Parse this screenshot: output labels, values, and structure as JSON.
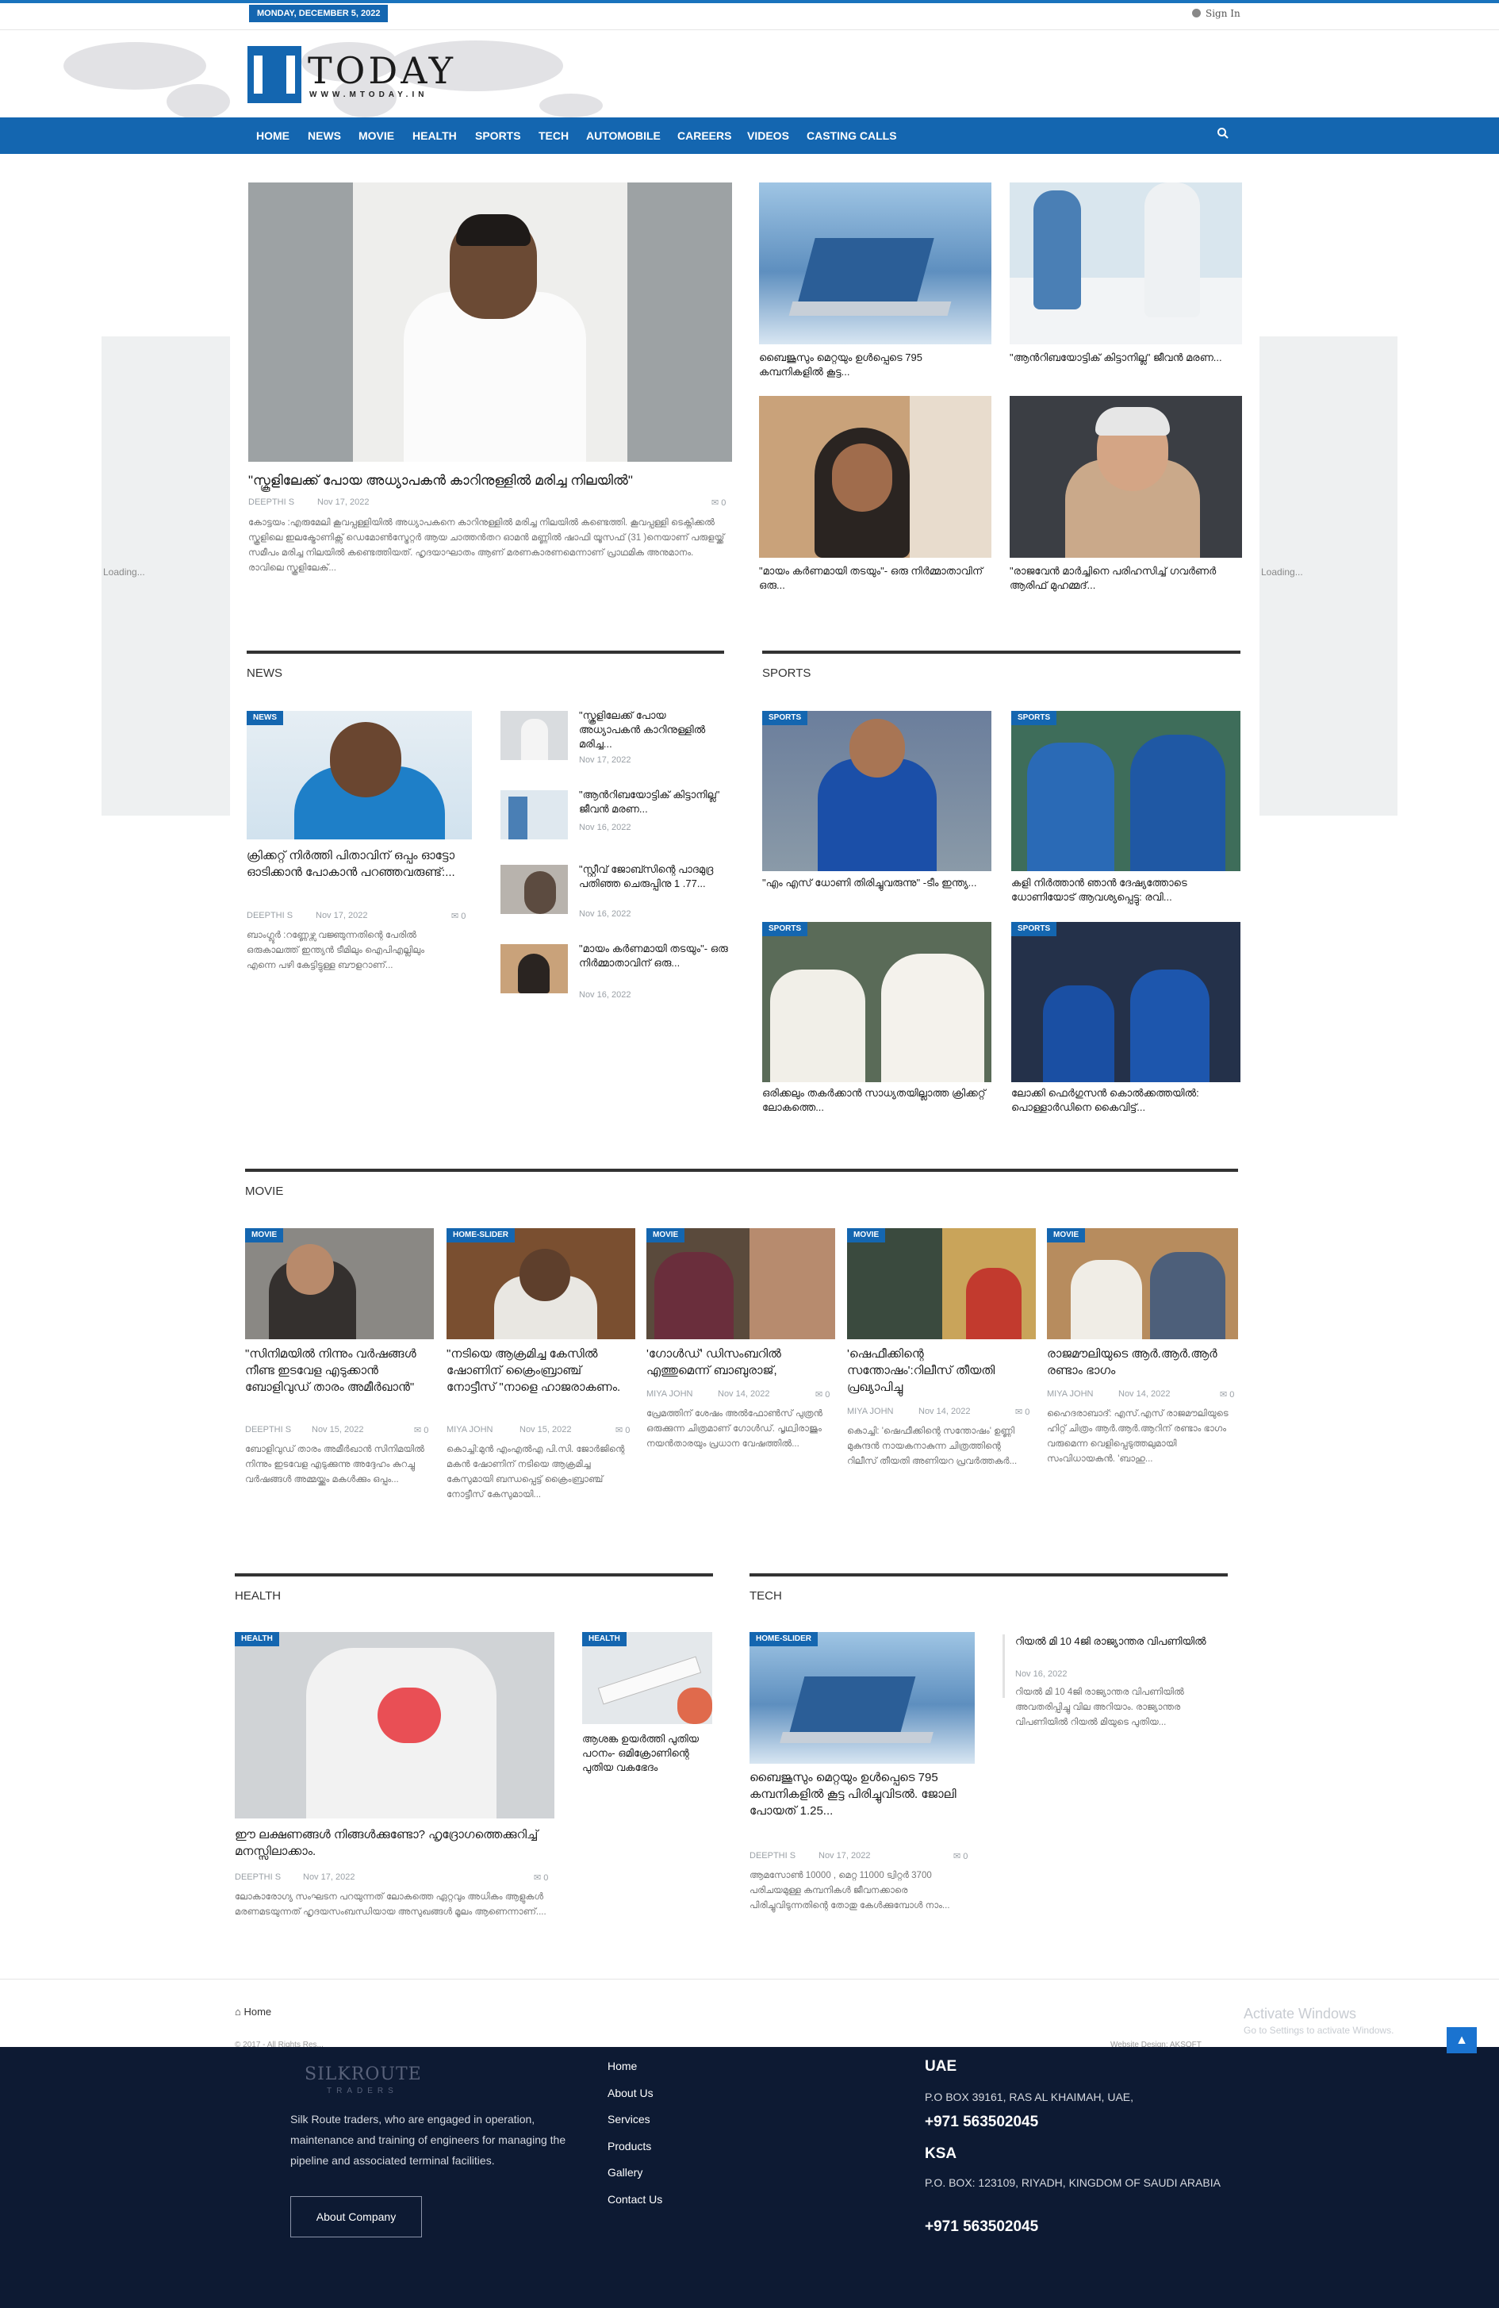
{
  "topbar": {
    "date": "MONDAY, DECEMBER 5, 2022",
    "signin": "Sign In"
  },
  "logo": {
    "word": "TODAY",
    "url": "WWW.MTODAY.IN"
  },
  "nav": {
    "items": [
      "HOME",
      "NEWS",
      "MOVIE",
      "HEALTH",
      "SPORTS",
      "TECH",
      "AUTOMOBILE",
      "CAREERS",
      "VIDEOS",
      "CASTING CALLS"
    ]
  },
  "side": {
    "loading": "Loading..."
  },
  "featured": {
    "main": {
      "title": "\"സ്കൂളിലേക്ക് പോയ അധ്യാപകൻ കാറിനുള്ളിൽ മരിച്ച നിലയിൽ\"",
      "author": "DEEPTHI S",
      "date": "Nov 17, 2022",
      "comments": "0",
      "excerpt": "കോട്ടയം :എരുമേലി കൂവപ്പള്ളിയിൽ അധ്യാപകനെ കാറിനുള്ളിൽ മരിച്ച നിലയിൽ കണ്ടെത്തി. കൂവപ്പള്ളി ടെക്നിക്കൽ സ്കൂളിലെ ഇലക്ട്രോണിക്സ് ഡെമോൺസ്ട്രേറ്റർ ആയ ചാത്തൻതറ ഓമൻ മണ്ണിൽ ഷാഫി യൂസഫ് (31 )നെയാണ് പരുളയ്ക്ക് സമീപം മരിച്ച നിലയിൽ കണ്ടെത്തിയത്. ഹൃദയാഘാതം ആണ് മരണകാരണമെന്നാണ് പ്രാഥമിക അനുമാനം. രാവിലെ സ്കൂളിലേക്..."
    },
    "grid": [
      {
        "title": "ബൈജൂസും മെറ്റയും ഉൾപ്പെടെ 795 കമ്പനികളിൽ കൂട്ട..."
      },
      {
        "title": "\"ആൻറിബയോട്ടിക് കിട്ടാനില്ല\" ജീവൻ മരണ..."
      },
      {
        "title": "\"മായം കർണമായി തടയും\"- ഒരു നിർമ്മാതാവിന് ഒരു..."
      },
      {
        "title": "\"രാജവേൻ മാർച്ചിനെ പരിഹസിച്ച് ഗവർണർ ആരിഫ് മുഹമ്മദ്..."
      }
    ]
  },
  "news": {
    "header": "NEWS",
    "main": {
      "tag": "NEWS",
      "title": "ക്രിക്കറ്റ് നിർത്തി പിതാവിന് ഒപ്പം ഓട്ടോ ഓടിക്കാൻ പോകാൻ പറഞ്ഞവരുണ്ട്:...",
      "author": "DEEPTHI S",
      "date": "Nov 17, 2022",
      "comments": "0",
      "excerpt": "ബാംഗ്ലൂർ :റണ്ണേഴ്സ വജ്ഞുന്നതിന്റെ പേരിൽ ഒരുകാലത്ത് ഇന്ത്യൻ ടീമിലും ഐപിഎല്ലിലും എന്നെ പഴി കേട്ടിട്ടുള്ള ബൗളറാണ്..."
    },
    "list": [
      {
        "title": "\"സ്കൂളിലേക്ക് പോയ അധ്യാപകൻ കാറിനുള്ളിൽ മരിച്ച...",
        "date": "Nov 17, 2022"
      },
      {
        "title": "\"ആൻറിബയോട്ടിക് കിട്ടാനില്ല\" ജീവൻ മരണ...",
        "date": "Nov 16, 2022"
      },
      {
        "title": "\"സ്റ്റീവ് ജോബ്സിന്റെ പാദമുദ്ര പതിഞ്ഞ ചെരുപ്പിനു 1 .77...",
        "date": "Nov 16, 2022"
      },
      {
        "title": "\"മായം കർണമായി തടയും\"- ഒരു നിർമ്മാതാവിന് ഒരു...",
        "date": "Nov 16, 2022"
      }
    ]
  },
  "sports": {
    "header": "SPORTS",
    "items": [
      {
        "tag": "SPORTS",
        "title": "\"എം എസ് ധോണി തിരിച്ചുവരുന്നു\" -ടീം ഇന്ത്യ..."
      },
      {
        "tag": "SPORTS",
        "title": "കളി നിർത്താൻ ഞാൻ ദേഷ്യത്തോടെ ധോണിയോട് ആവശ്യപ്പെട്ടു: രവി..."
      },
      {
        "tag": "SPORTS",
        "title": "ഒരിക്കലും തകർക്കാൻ സാധ്യതയില്ലാത്ത ക്രിക്കറ്റ് ലോകത്തെ..."
      },
      {
        "tag": "SPORTS",
        "title": "ലോക്കി ഫെർഗുസൻ കൊൽക്കത്തയിൽ: പൊള്ളാർഡിനെ കൈവിട്ട്..."
      }
    ]
  },
  "movie": {
    "header": "MOVIE",
    "items": [
      {
        "tag": "MOVIE",
        "title": "\"സിനിമയിൽ നിന്നും വർഷങ്ങൾ നീണ്ട ഇടവേള എടുക്കാൻ ബോളിവുഡ് താരം അമീർഖാൻ\"",
        "author": "DEEPTHI S",
        "date": "Nov 15, 2022",
        "comments": "0",
        "excerpt": "ബോളിവുഡ് താരം അമീർഖാൻ സിനിമയിൽ നിന്നും ഇടവേള എടുക്കുന്നു അദ്ദേഹം കുറച്ചു വർഷങ്ങൾ അമ്മയ്ക്കും മകൾക്കും ഒപ്പം..."
      },
      {
        "tag": "HOME-SLIDER",
        "title": "\"നടിയെ ആക്രമിച്ച കേസിൽ ഷോണിന് ക്രൈംബ്രാഞ്ച് നോട്ടീസ് \"നാളെ ഹാജരാകണം.",
        "author": "MIYA JOHN",
        "date": "Nov 15, 2022",
        "comments": "0",
        "excerpt": "കൊച്ചി:മുൻ എംഎൽഎ പി.സി. ജോർജിന്റെ മകൻ ഷോണിന് നടിയെ ആക്രമിച്ച കേസുമായി ബന്ധപ്പെട്ട് ക്രൈംബ്രാഞ്ച് നോട്ടീസ് കേസുമായി..."
      },
      {
        "tag": "MOVIE",
        "title": "'ഗോൾഡ്' ഡിസംബറിൽ എത്തുമെന്ന് ബാബുരാജ്,",
        "author": "MIYA JOHN",
        "date": "Nov 14, 2022",
        "comments": "0",
        "excerpt": "പ്രേമത്തിന് ശേഷം അൽഫോൺസ് പുത്രൻ ഒരുക്കുന്ന ചിത്രമാണ് ഗോൾഡ്. പൃഥ്വിരാജും നയൻതാരയും പ്രധാന വേഷത്തിൽ..."
      },
      {
        "tag": "MOVIE",
        "title": "'ഷെഫീക്കിന്റെ സന്തോഷം':റിലീസ് തീയതി പ്രഖ്യാപിച്ചു",
        "author": "MIYA JOHN",
        "date": "Nov 14, 2022",
        "comments": "0",
        "excerpt": "കൊച്ചി: 'ഷെഫീക്കിന്റെ സന്തോഷം' ഉണ്ണി മുകുന്ദൻ നായകനാകുന്ന ചിത്രത്തിന്റെ റിലീസ് തീയതി അണിയറ പ്രവർത്തകർ..."
      },
      {
        "tag": "MOVIE",
        "title": "രാജമൗലിയുടെ ആർ.ആർ.ആർ രണ്ടാം ഭാഗം",
        "author": "MIYA JOHN",
        "date": "Nov 14, 2022",
        "comments": "0",
        "excerpt": "ഹൈദരാബാദ്: എസ്.എസ് രാജമൗലിയുടെ ഹിറ്റ് ചിത്രം ആർ.ആർ.ആറിന് രണ്ടാം ഭാഗം വരുമെന്ന വെളിപ്പെടുത്തലുമായി സംവിധായകൻ. 'ബാഹു..."
      }
    ]
  },
  "health": {
    "header": "HEALTH",
    "main": {
      "tag": "HEALTH",
      "title": "ഈ ലക്ഷണങ്ങൾ നിങ്ങൾക്കുണ്ടോ? ഹൃദ്രോഗത്തെക്കുറിച്ച് മനസ്സിലാക്കാം.",
      "author": "DEEPTHI S",
      "date": "Nov 17, 2022",
      "comments": "0",
      "excerpt": "ലോകാരോഗ്യ സംഘടന പറയുന്നത് ലോകത്തെ ഏറ്റവും അധികം ആളുകൾ മരണമടയുന്നത് ഹൃദയസംബന്ധിയായ അസുഖങ്ങൾ മൂലം ആണെന്നാണ്...."
    },
    "side": {
      "tag": "HEALTH",
      "title": "ആശങ്ക ഉയർത്തി പുതിയ പഠനം- ഒമിക്രോണിന്റെ പുതിയ വകഭേദം"
    }
  },
  "tech": {
    "header": "TECH",
    "main": {
      "tag": "HOME-SLIDER",
      "title": "ബൈജൂസും മെറ്റയും ഉൾപ്പെടെ 795 കമ്പനികളിൽ കൂട്ട പിരിച്ചുവിടൽ. ജോലി പോയത് 1.25...",
      "author": "DEEPTHI S",
      "date": "Nov 17, 2022",
      "comments": "0",
      "excerpt": "ആമസോൺ 10000 , മെറ്റ 11000 ട്വിറ്റർ 3700 പരിചയമുള്ള കമ്പനികൾ ജീവനക്കാരെ പിരിച്ചുവിടുന്നതിന്റെ തോതു കേൾക്കുമ്പോൾ നാം..."
    },
    "side": {
      "title": "റിയൽ മി 10 4ജി രാജ്യാന്തര വിപണിയിൽ",
      "date": "Nov 16, 2022",
      "excerpt": "റിയൽ മി 10 4ജി രാജ്യാന്തര വിപണിയിൽ അവതരിപ്പിച്ചു വില അറിയാം. രാജ്യാന്തര വിപണിയിൽ റിയൽ മിയുടെ പുതിയ..."
    }
  },
  "bottom": {
    "home": "Home",
    "copyright": "© 2017 - All Rights Res...",
    "design": "Website Design: AKSOFT",
    "activate_title": "Activate Windows",
    "activate_sub": "Go to Settings to activate Windows."
  },
  "footer": {
    "brand": "SILKROUTE",
    "brand_sub": "TRADERS",
    "about": "Silk Route traders, who are engaged in operation, maintenance and training of engineers for managing the pipeline and associated terminal facilities.",
    "about_button": "About Company",
    "links": [
      "Home",
      "About Us",
      "Services",
      "Products",
      "Gallery",
      "Contact Us"
    ],
    "uae_title": "UAE",
    "uae_address": "P.O BOX 39161, RAS AL KHAIMAH, UAE,",
    "uae_phone": "+971 563502045",
    "ksa_title": "KSA",
    "ksa_address": "P.O. BOX: 123109, RIYADH, KINGDOM OF SAUDI ARABIA",
    "ksa_phone": "+971 563502045"
  },
  "colors": {
    "brand_blue": "#1466b0",
    "footer_bg": "#0d1a33"
  }
}
